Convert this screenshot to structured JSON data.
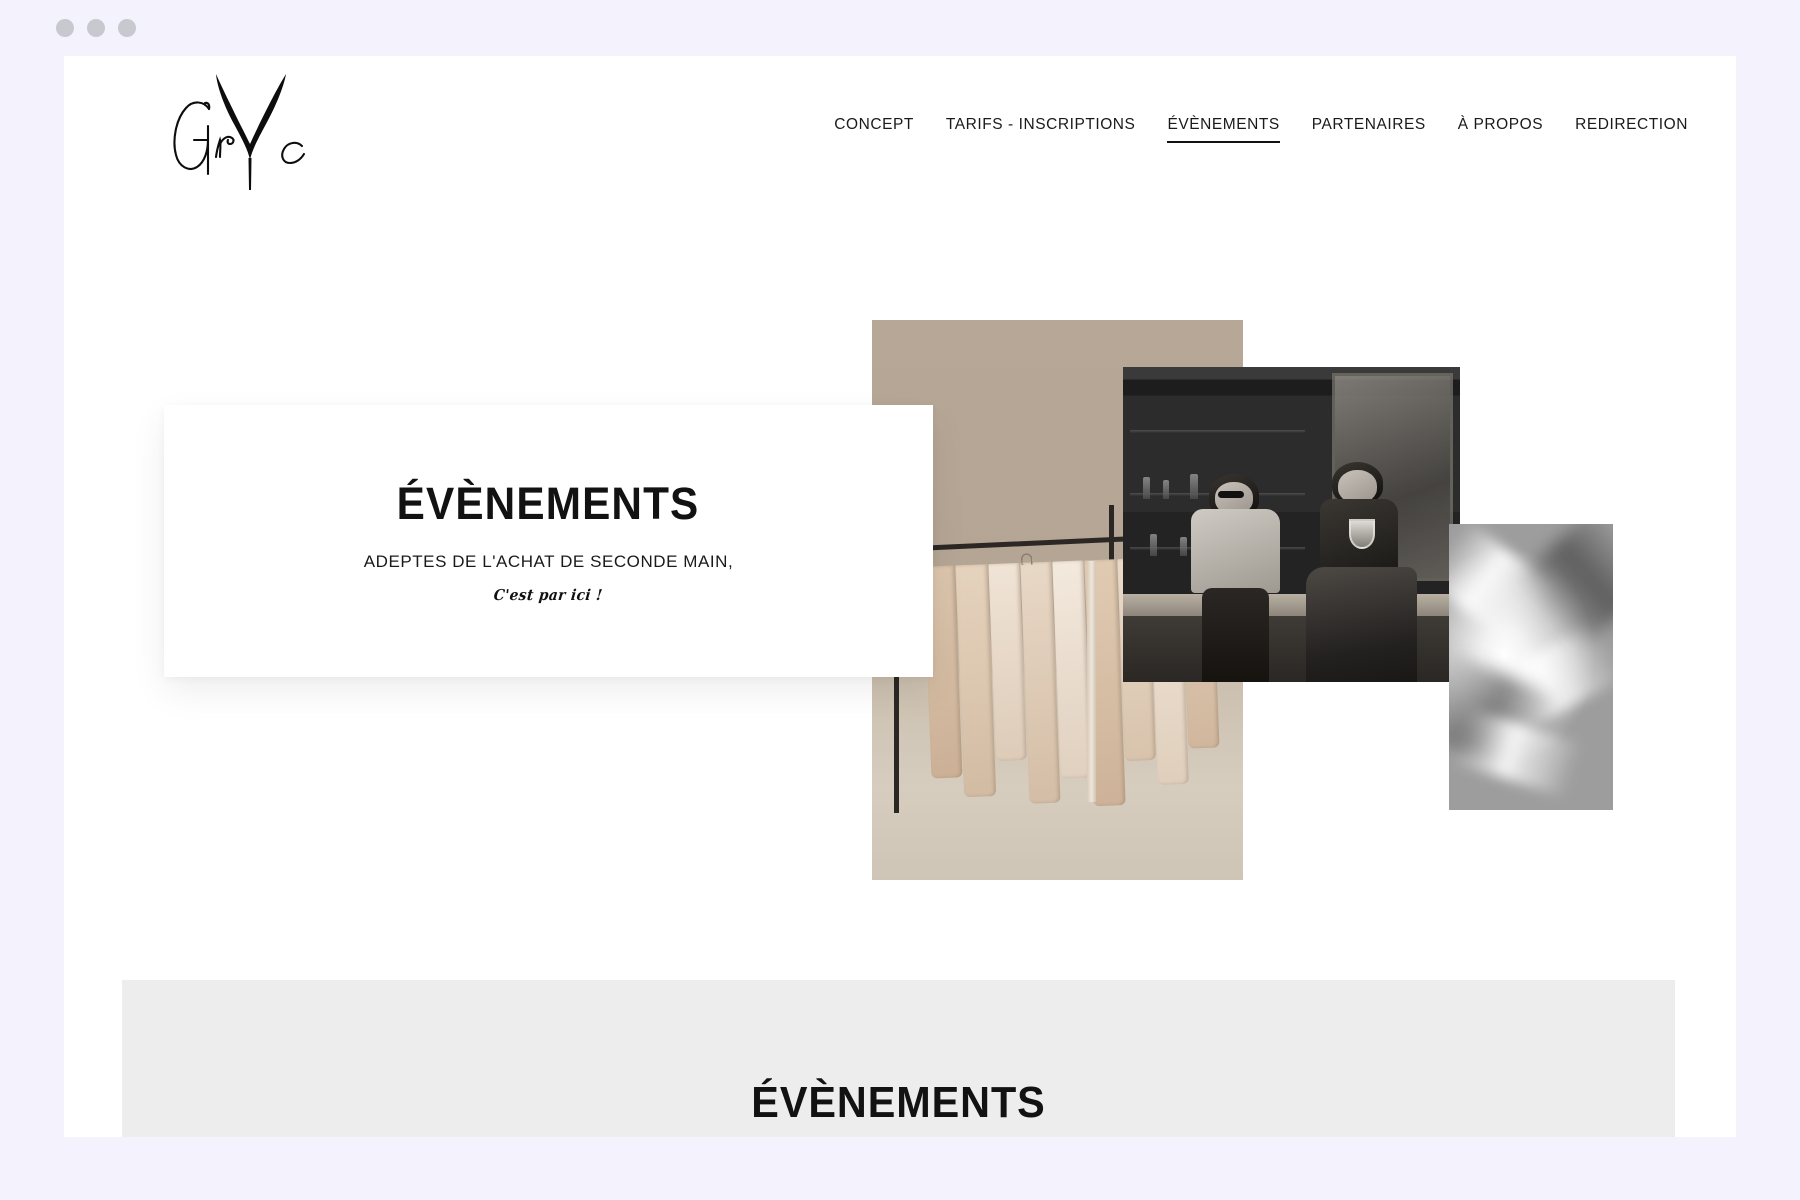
{
  "window": {
    "dots": [
      "close-dot",
      "minimize-dot",
      "maximize-dot"
    ],
    "background_color": "#f4f2fc",
    "page_background": "#ffffff"
  },
  "header": {
    "logo": {
      "name": "grvc-logo",
      "letters": "Gr V c",
      "alt": "GRVC handwritten logo"
    },
    "nav": [
      {
        "label": "CONCEPT",
        "active": false
      },
      {
        "label": "TARIFS - INSCRIPTIONS",
        "active": false
      },
      {
        "label": "ÉVÈNEMENTS",
        "active": true
      },
      {
        "label": "PARTENAIRES",
        "active": false
      },
      {
        "label": "À PROPOS",
        "active": false
      },
      {
        "label": "REDIRECTION",
        "active": false
      }
    ]
  },
  "hero": {
    "title": "ÉVÈNEMENTS",
    "subtitle": "ADEPTES DE L'ACHAT DE SECONDE MAIN,",
    "script_line": "C'est par ici !",
    "images": [
      {
        "name": "clothing-rack-photo",
        "description": "Beige clothing rack with pastel garments"
      },
      {
        "name": "bar-scene-photo",
        "description": "Black and white photo of two women laughing at a bar"
      },
      {
        "name": "satin-fabric-photo",
        "description": "Black and white close-up of draped satin fabric"
      }
    ]
  },
  "section": {
    "title": "ÉVÈNEMENTS",
    "background_color": "#ededed"
  },
  "colors": {
    "accent": "#111111",
    "page_bg": "#ffffff",
    "chrome_bg": "#f4f2fc",
    "band_bg": "#ededed",
    "dot": "#c8c8cf"
  }
}
